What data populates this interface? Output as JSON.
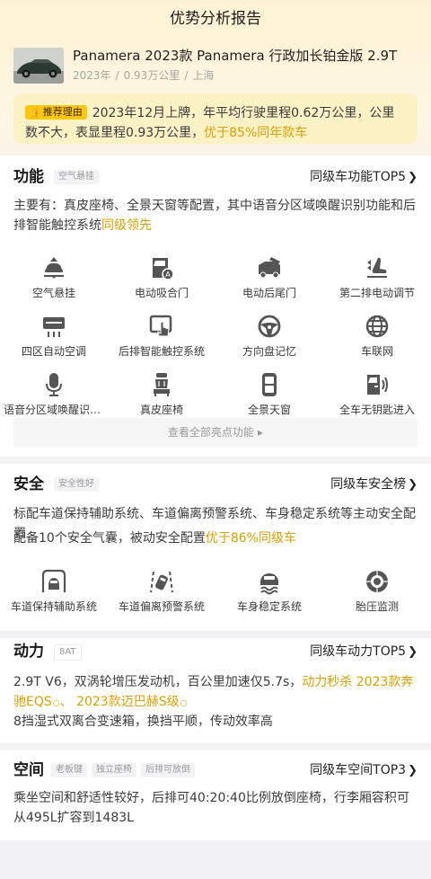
{
  "page": {
    "title": "优势分析报告"
  },
  "car": {
    "name": "Panamera 2023款 Panamera 行政加长铂金版 2.9T",
    "year": "2023年",
    "mileage": "0.93万公里",
    "city": "上海",
    "sep": "/"
  },
  "recommend": {
    "badge": "推荐理由",
    "text": "2023年12月上牌，年平均行驶里程0.62万公里，公里数不大，表显里程0.93万公里，",
    "highlight": "优于85%同年款车"
  },
  "features": {
    "title": "功能",
    "tags": [
      "空气悬挂"
    ],
    "rank": "同级车功能TOP5",
    "desc": "主要有：真皮座椅、全景天窗等配置，其中语音分区域唤醒识别功能和后排智能触控系统",
    "desc_highlight": "同级领先",
    "items": [
      {
        "label": "空气悬挂",
        "icon": "air-suspension-icon"
      },
      {
        "label": "电动吸合门",
        "icon": "soft-close-door-icon"
      },
      {
        "label": "电动后尾门",
        "icon": "power-tailgate-icon"
      },
      {
        "label": "第二排电动调节",
        "icon": "power-seat-icon"
      },
      {
        "label": "四区自动空调",
        "icon": "climate-control-icon"
      },
      {
        "label": "后排智能触控系统",
        "icon": "touch-panel-icon"
      },
      {
        "label": "方向盘记忆",
        "icon": "steering-wheel-icon"
      },
      {
        "label": "车联网",
        "icon": "globe-icon"
      },
      {
        "label": "语音分区域唤醒识别功能",
        "icon": "microphone-icon"
      },
      {
        "label": "真皮座椅",
        "icon": "leather-seat-icon"
      },
      {
        "label": "全景天窗",
        "icon": "sunroof-icon"
      },
      {
        "label": "全车无钥匙进入",
        "icon": "keyless-entry-icon"
      }
    ],
    "more": "查看全部亮点功能"
  },
  "safety": {
    "title": "安全",
    "tags": [
      "安全性好"
    ],
    "rank": "同级车安全榜",
    "line1": "标配车道保持辅助系统、车道偏离预警系统、车身稳定系统等主动安全配置",
    "line2": "配备10个安全气囊，被动安全配置",
    "line2_highlight": "优于86%同级车",
    "items": [
      {
        "label": "车道保持辅助系统",
        "icon": "lane-keep-icon"
      },
      {
        "label": "车道偏离预警系统",
        "icon": "lane-departure-icon"
      },
      {
        "label": "车身稳定系统",
        "icon": "stability-control-icon"
      },
      {
        "label": "胎压监测",
        "icon": "tire-pressure-icon"
      }
    ]
  },
  "power": {
    "title": "动力",
    "tags": [
      "8AT"
    ],
    "rank": "同级车动力TOP5",
    "line1": "2.9T V6，双涡轮增压发动机，百公里加速仅5.7s，",
    "line1_highlight": "动力秒杀",
    "compare1": "2023款奔驰EQS",
    "compare_sep": "、",
    "compare2": "2023款迈巴赫S级",
    "line2": "8挡湿式双离合变速箱，换挡平顺，传动效率高"
  },
  "space": {
    "title": "空间",
    "tags": [
      "老板键",
      "独立座椅",
      "后排可放倒"
    ],
    "rank": "同级车空间TOP3",
    "desc": "乘坐空间和舒适性较好，后排可40:20:40比例放倒座椅，行李厢容积可从495L扩容到1483L"
  },
  "colors": {
    "accent": "#d4a106",
    "badge": "#ffc80f",
    "recommend_bg": "#fdf1c6"
  }
}
